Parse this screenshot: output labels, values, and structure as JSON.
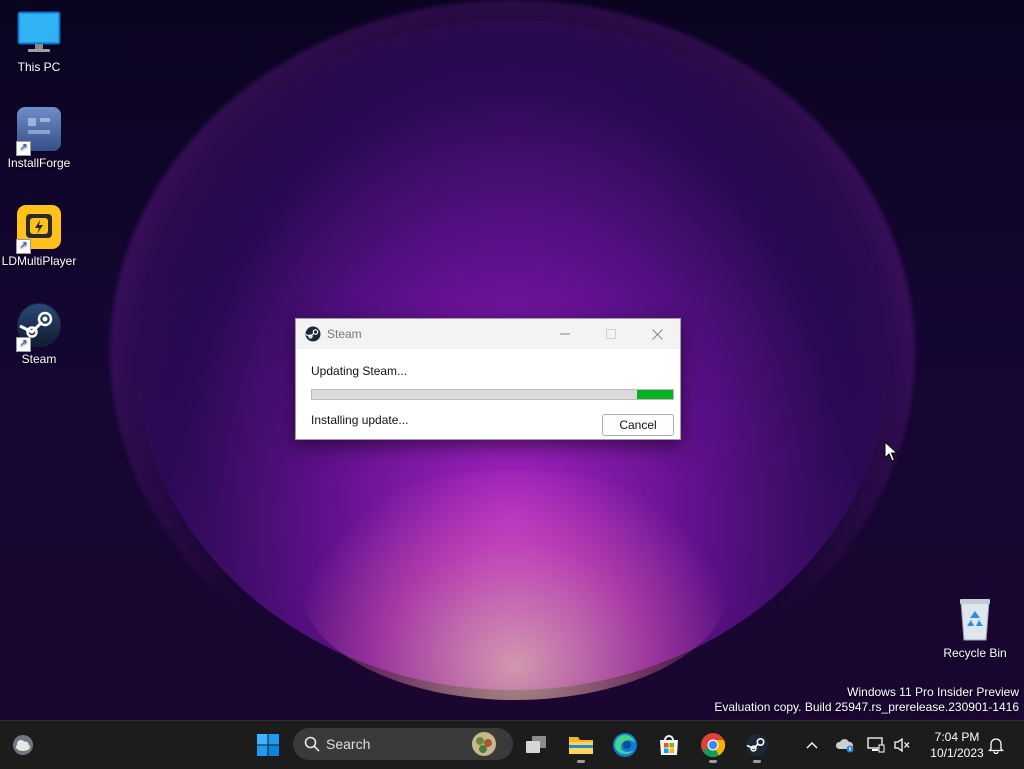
{
  "desktop": {
    "icons": [
      {
        "label": "This PC",
        "icon": "monitor-icon"
      },
      {
        "label": "InstallForge",
        "icon": "installforge-icon"
      },
      {
        "label": "LDMultiPlayer",
        "icon": "ldmultiplayer-icon"
      },
      {
        "label": "Steam",
        "icon": "steam-icon"
      },
      {
        "label": "Recycle Bin",
        "icon": "recycle-bin-icon"
      }
    ],
    "watermark": {
      "line1": "Windows 11 Pro Insider Preview",
      "line2": "Evaluation copy. Build 25947.rs_prerelease.230901-1416"
    }
  },
  "dialog": {
    "title": "Steam",
    "status": "Updating Steam...",
    "progress_percent": 10,
    "substatus": "Installing update...",
    "cancel_label": "Cancel",
    "accent": "#06b025"
  },
  "taskbar": {
    "search_placeholder": "Search",
    "clock": {
      "time": "7:04 PM",
      "date": "10/1/2023"
    }
  }
}
